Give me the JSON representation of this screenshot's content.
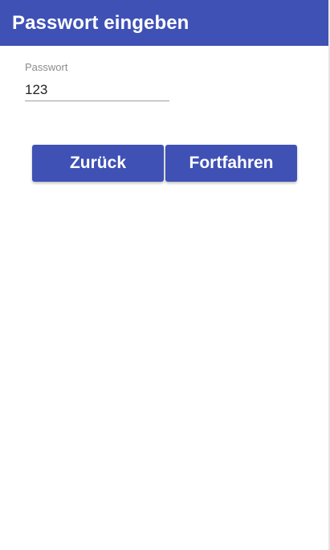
{
  "app_bar": {
    "title": "Passwort eingeben",
    "color": "#3f51b5"
  },
  "password_field": {
    "label": "Passwort",
    "value": "123"
  },
  "actions": {
    "back_label": "Zurück",
    "continue_label": "Fortfahren"
  }
}
